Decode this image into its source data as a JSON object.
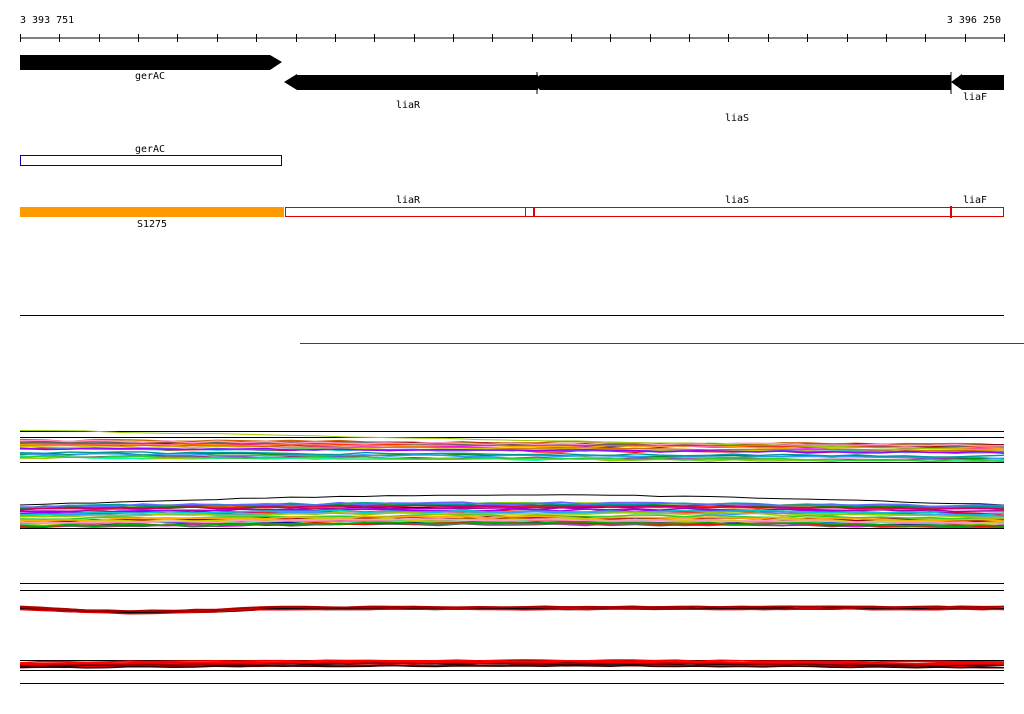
{
  "ruler": {
    "start_label": "3 393 751",
    "end_label": "3 396 250"
  },
  "genes": [
    {
      "id": "gerAC",
      "label": "gerAC",
      "strand": "+"
    },
    {
      "id": "liaR",
      "label": "liaR",
      "strand": "-"
    },
    {
      "id": "liaS",
      "label": "liaS",
      "strand": "-"
    },
    {
      "id": "liaF",
      "label": "liaF",
      "strand": "-"
    }
  ],
  "blue_track": {
    "label": "gerAC"
  },
  "red_track": {
    "segments": [
      {
        "label": "S1275",
        "fill": "#ff9900"
      },
      {
        "label": "liaR",
        "fill": "none"
      },
      {
        "label": "",
        "fill": "none"
      },
      {
        "label": "liaS",
        "fill": "none"
      },
      {
        "label": "liaF",
        "fill": "none"
      }
    ]
  },
  "colors": {
    "gene_arrow": "#000000",
    "blue_box": "#0000aa",
    "red_box": "#dd0000",
    "orange_fill": "#ff9900",
    "threshold_line": "#dd0000"
  }
}
